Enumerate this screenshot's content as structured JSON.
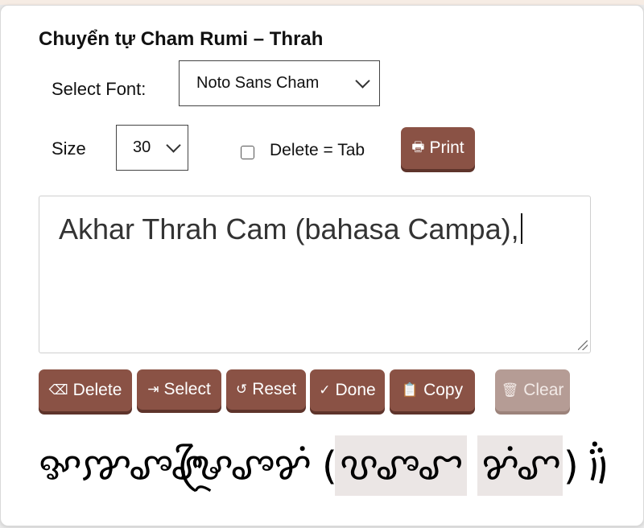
{
  "title": "Chuyển tự Cham Rumi – Thrah",
  "font_select": {
    "label": "Select Font:",
    "value": "Noto Sans Cham"
  },
  "size_select": {
    "label": "Size",
    "value": "30"
  },
  "delete_tab": {
    "label": "Delete = Tab",
    "checked": false
  },
  "print_button": {
    "icon": "🖶",
    "label": "Print"
  },
  "input": {
    "text": "Akhar Thrah Cam (bahasa Campa),"
  },
  "buttons": {
    "delete": {
      "icon": "⌫",
      "label": "Delete"
    },
    "select": {
      "icon": "⇥",
      "label": "Select"
    },
    "reset": {
      "icon": "↺",
      "label": "Reset"
    },
    "done": {
      "icon": "✓",
      "label": "Done"
    },
    "copy": {
      "icon": "📋",
      "label": "Copy"
    },
    "clear": {
      "icon": "🗑",
      "label": "Clear"
    }
  },
  "output": {
    "word1": "ꨀꨇꨨꨣ",
    "word2": "ꨔꨴꨨ",
    "word3": "ꨌꩌ",
    "open_paren": "(",
    "word4": "ꨝꨨꨧ",
    "word5": "ꨌꩌꨚ",
    "close_paren": ")",
    "comma": "꩞"
  },
  "colors": {
    "button": "#8a5245",
    "button_disabled": "#b59c95",
    "highlight": "#ebe6e5"
  }
}
